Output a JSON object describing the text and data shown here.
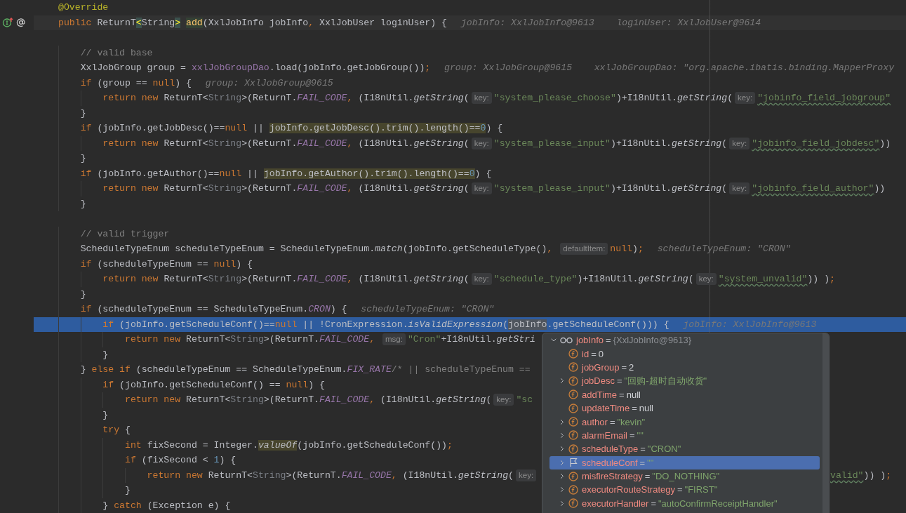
{
  "editor": {
    "lines": [
      {
        "kind": "plain",
        "tokens": [
          {
            "kind": "annotation",
            "text": "@Override"
          }
        ]
      },
      {
        "kind": "caret",
        "gutter_icons": [
          {
            "kind": "implements"
          },
          {
            "kind": "annotation"
          }
        ],
        "tokens": [
          {
            "kind": "keyword",
            "text": "public "
          },
          {
            "kind": "code",
            "text": "ReturnT"
          },
          {
            "kind": "brace",
            "text": "<"
          },
          {
            "kind": "code",
            "text": "String"
          },
          {
            "kind": "brace",
            "text": ">"
          },
          {
            "kind": "declaration",
            "text": "add",
            "highlighted": true
          },
          {
            "kind": "code",
            "text": "(XxlJobInfo jobInfo"
          },
          {
            "kind": "keyword",
            "text": ", "
          },
          {
            "kind": "code",
            "text": "XxlJobUser loginUser) {"
          },
          {
            "kind": "value",
            "text": "jobInfo: XxlJobInfo@9613"
          },
          {
            "kind": "value",
            "text": "loginUser: XxlJobUser@9614"
          }
        ]
      },
      {
        "kind": "plain"
      },
      {
        "kind": "plain",
        "tokens": [
          {
            "kind": "comment",
            "text": "    // valid base"
          }
        ]
      },
      {
        "kind": "plain",
        "tokens": [
          {
            "kind": "code",
            "text": "    XxlJobGroup group = "
          },
          {
            "kind": "field",
            "text": "xxlJobGroupDao"
          },
          {
            "kind": "code",
            "text": ".load(jobInfo.getJobGroup())"
          },
          {
            "kind": "keyword",
            "text": ";"
          },
          {
            "kind": "value",
            "text": "group: XxlJobGroup@9615"
          },
          {
            "kind": "value",
            "text": "xxlJobGroupDao: \"org.apache.ibatis.binding.MapperProxy"
          }
        ]
      },
      {
        "kind": "plain",
        "tokens": [
          {
            "kind": "keyword",
            "text": "    if "
          },
          {
            "kind": "code",
            "text": "(group == "
          },
          {
            "kind": "keyword",
            "text": "null"
          },
          {
            "kind": "code",
            "text": ") {"
          },
          {
            "kind": "value",
            "text": "group: XxlJobGroup@9615"
          }
        ]
      },
      {
        "kind": "plain",
        "tokens": [
          {
            "kind": "keyword",
            "text": "        return new "
          },
          {
            "kind": "code",
            "text": "ReturnT<"
          },
          {
            "kind": "generic",
            "text": "String"
          },
          {
            "kind": "code",
            "text": ">(ReturnT."
          },
          {
            "kind": "constant",
            "text": "FAIL_CODE"
          },
          {
            "kind": "keyword",
            "text": ", "
          },
          {
            "kind": "code",
            "text": "(I18nUtil."
          },
          {
            "kind": "italic",
            "text": "getString"
          },
          {
            "kind": "code",
            "text": "("
          },
          {
            "kind": "hint",
            "text": "key:"
          },
          {
            "kind": "string",
            "text": "\"system_please_choose\""
          },
          {
            "kind": "code",
            "text": ")+I18nUtil."
          },
          {
            "kind": "italic",
            "text": "getString"
          },
          {
            "kind": "code",
            "text": "("
          },
          {
            "kind": "hint",
            "text": "key:"
          },
          {
            "kind": "string",
            "text": "\"jobinfo_field_jobgroup\"",
            "wavy": true
          }
        ]
      },
      {
        "kind": "plain",
        "tokens": [
          {
            "kind": "code",
            "text": "    }"
          }
        ]
      },
      {
        "kind": "plain",
        "tokens": [
          {
            "kind": "keyword",
            "text": "    if "
          },
          {
            "kind": "code",
            "text": "(jobInfo.getJobDesc()=="
          },
          {
            "kind": "keyword",
            "text": "null "
          },
          {
            "kind": "code",
            "text": "|| "
          },
          {
            "kind": "code",
            "text": "jobInfo.getJobDesc().trim().length()==",
            "highlighted": true
          },
          {
            "kind": "number",
            "text": "0",
            "highlighted": true
          },
          {
            "kind": "code",
            "text": ") {"
          }
        ]
      },
      {
        "kind": "plain",
        "tokens": [
          {
            "kind": "keyword",
            "text": "        return new "
          },
          {
            "kind": "code",
            "text": "ReturnT<"
          },
          {
            "kind": "generic",
            "text": "String"
          },
          {
            "kind": "code",
            "text": ">(ReturnT."
          },
          {
            "kind": "constant",
            "text": "FAIL_CODE"
          },
          {
            "kind": "keyword",
            "text": ", "
          },
          {
            "kind": "code",
            "text": "(I18nUtil."
          },
          {
            "kind": "italic",
            "text": "getString"
          },
          {
            "kind": "code",
            "text": "("
          },
          {
            "kind": "hint",
            "text": "key:"
          },
          {
            "kind": "string",
            "text": "\"system_please_input\""
          },
          {
            "kind": "code",
            "text": ")+I18nUtil."
          },
          {
            "kind": "italic",
            "text": "getString"
          },
          {
            "kind": "code",
            "text": "("
          },
          {
            "kind": "hint",
            "text": "key:"
          },
          {
            "kind": "string",
            "text": "\"jobinfo_field_jobdesc\"",
            "wavy": true
          },
          {
            "kind": "code",
            "text": "))"
          }
        ]
      },
      {
        "kind": "plain",
        "tokens": [
          {
            "kind": "code",
            "text": "    }"
          }
        ]
      },
      {
        "kind": "plain",
        "tokens": [
          {
            "kind": "keyword",
            "text": "    if "
          },
          {
            "kind": "code",
            "text": "(jobInfo.getAuthor()=="
          },
          {
            "kind": "keyword",
            "text": "null "
          },
          {
            "kind": "code",
            "text": "|| "
          },
          {
            "kind": "code",
            "text": "jobInfo.getAuthor().trim().length()==",
            "highlighted": true
          },
          {
            "kind": "number",
            "text": "0",
            "highlighted": true
          },
          {
            "kind": "code",
            "text": ") {"
          }
        ]
      },
      {
        "kind": "plain",
        "tokens": [
          {
            "kind": "keyword",
            "text": "        return new "
          },
          {
            "kind": "code",
            "text": "ReturnT<"
          },
          {
            "kind": "generic",
            "text": "String"
          },
          {
            "kind": "code",
            "text": ">(ReturnT."
          },
          {
            "kind": "constant",
            "text": "FAIL_CODE"
          },
          {
            "kind": "keyword",
            "text": ", "
          },
          {
            "kind": "code",
            "text": "(I18nUtil."
          },
          {
            "kind": "italic",
            "text": "getString"
          },
          {
            "kind": "code",
            "text": "("
          },
          {
            "kind": "hint",
            "text": "key:"
          },
          {
            "kind": "string",
            "text": "\"system_please_input\""
          },
          {
            "kind": "code",
            "text": ")+I18nUtil."
          },
          {
            "kind": "italic",
            "text": "getString"
          },
          {
            "kind": "code",
            "text": "("
          },
          {
            "kind": "hint",
            "text": "key:"
          },
          {
            "kind": "string",
            "text": "\"jobinfo_field_author\"",
            "wavy": true
          },
          {
            "kind": "code",
            "text": "))"
          }
        ]
      },
      {
        "kind": "plain",
        "tokens": [
          {
            "kind": "code",
            "text": "    }"
          }
        ]
      },
      {
        "kind": "plain"
      },
      {
        "kind": "plain",
        "tokens": [
          {
            "kind": "comment",
            "text": "    // valid trigger"
          }
        ]
      },
      {
        "kind": "plain",
        "tokens": [
          {
            "kind": "code",
            "text": "    ScheduleTypeEnum scheduleTypeEnum = ScheduleTypeEnum."
          },
          {
            "kind": "italic",
            "text": "match"
          },
          {
            "kind": "code",
            "text": "(jobInfo.getScheduleType()"
          },
          {
            "kind": "keyword",
            "text": ", "
          },
          {
            "kind": "hint",
            "text": "defaultItem:"
          },
          {
            "kind": "keyword",
            "text": "null"
          },
          {
            "kind": "code",
            "text": ")"
          },
          {
            "kind": "keyword",
            "text": ";"
          },
          {
            "kind": "value",
            "text": "scheduleTypeEnum: \"CRON\""
          }
        ]
      },
      {
        "kind": "plain",
        "tokens": [
          {
            "kind": "keyword",
            "text": "    if "
          },
          {
            "kind": "code",
            "text": "(scheduleTypeEnum == "
          },
          {
            "kind": "keyword",
            "text": "null"
          },
          {
            "kind": "code",
            "text": ") {"
          }
        ]
      },
      {
        "kind": "plain",
        "tokens": [
          {
            "kind": "keyword",
            "text": "        return new "
          },
          {
            "kind": "code",
            "text": "ReturnT<"
          },
          {
            "kind": "generic",
            "text": "String"
          },
          {
            "kind": "code",
            "text": ">(ReturnT."
          },
          {
            "kind": "constant",
            "text": "FAIL_CODE"
          },
          {
            "kind": "keyword",
            "text": ", "
          },
          {
            "kind": "code",
            "text": "(I18nUtil."
          },
          {
            "kind": "italic",
            "text": "getString"
          },
          {
            "kind": "code",
            "text": "("
          },
          {
            "kind": "hint",
            "text": "key:"
          },
          {
            "kind": "string",
            "text": "\"schedule_type\""
          },
          {
            "kind": "code",
            "text": ")+I18nUtil."
          },
          {
            "kind": "italic",
            "text": "getString"
          },
          {
            "kind": "code",
            "text": "("
          },
          {
            "kind": "hint",
            "text": "key:"
          },
          {
            "kind": "string",
            "text": "\"system_unvalid\"",
            "wavy": true
          },
          {
            "kind": "code",
            "text": ")) )"
          },
          {
            "kind": "keyword",
            "text": ";"
          }
        ]
      },
      {
        "kind": "plain",
        "tokens": [
          {
            "kind": "code",
            "text": "    }"
          }
        ]
      },
      {
        "kind": "plain",
        "tokens": [
          {
            "kind": "keyword",
            "text": "    if "
          },
          {
            "kind": "code",
            "text": "(scheduleTypeEnum == ScheduleTypeEnum."
          },
          {
            "kind": "constant",
            "text": "CRON"
          },
          {
            "kind": "code",
            "text": ") {"
          },
          {
            "kind": "value",
            "text": "scheduleTypeEnum: \"CRON\""
          }
        ]
      },
      {
        "kind": "current",
        "tokens": [
          {
            "kind": "keyword",
            "text": "        if "
          },
          {
            "kind": "code",
            "text": "(jobInfo.getScheduleConf()=="
          },
          {
            "kind": "keyword",
            "text": "null "
          },
          {
            "kind": "code",
            "text": "|| !CronExpression."
          },
          {
            "kind": "italic",
            "text": "isValidExpression"
          },
          {
            "kind": "code",
            "text": "("
          },
          {
            "kind": "code",
            "text": "jobInfo",
            "highlighted": true
          },
          {
            "kind": "code",
            "text": ".getScheduleConf())) {"
          },
          {
            "kind": "value",
            "text": "jobInfo: XxlJobInfo@9613"
          }
        ]
      },
      {
        "kind": "plain",
        "tokens": [
          {
            "kind": "keyword",
            "text": "            return new "
          },
          {
            "kind": "code",
            "text": "ReturnT<"
          },
          {
            "kind": "generic",
            "text": "String"
          },
          {
            "kind": "code",
            "text": ">(ReturnT."
          },
          {
            "kind": "constant",
            "text": "FAIL_CODE"
          },
          {
            "kind": "keyword",
            "text": ", "
          },
          {
            "kind": "hint",
            "text": "msg:"
          },
          {
            "kind": "string",
            "text": "\"Cron\""
          },
          {
            "kind": "code",
            "text": "+I18nUtil."
          },
          {
            "kind": "italic",
            "text": "getStri"
          }
        ]
      },
      {
        "kind": "plain",
        "tokens": [
          {
            "kind": "code",
            "text": "        }"
          }
        ]
      },
      {
        "kind": "plain",
        "tokens": [
          {
            "kind": "code",
            "text": "    } "
          },
          {
            "kind": "keyword",
            "text": "else if "
          },
          {
            "kind": "code",
            "text": "(scheduleTypeEnum == ScheduleTypeEnum."
          },
          {
            "kind": "constant",
            "text": "FIX_RATE"
          },
          {
            "kind": "comment",
            "text": "/* || scheduleTypeEnum =="
          }
        ]
      },
      {
        "kind": "plain",
        "tokens": [
          {
            "kind": "keyword",
            "text": "        if "
          },
          {
            "kind": "code",
            "text": "(jobInfo.getScheduleConf() == "
          },
          {
            "kind": "keyword",
            "text": "null"
          },
          {
            "kind": "code",
            "text": ") {"
          }
        ]
      },
      {
        "kind": "plain",
        "tokens": [
          {
            "kind": "keyword",
            "text": "            return new "
          },
          {
            "kind": "code",
            "text": "ReturnT<"
          },
          {
            "kind": "generic",
            "text": "String"
          },
          {
            "kind": "code",
            "text": ">(ReturnT."
          },
          {
            "kind": "constant",
            "text": "FAIL_CODE"
          },
          {
            "kind": "keyword",
            "text": ", "
          },
          {
            "kind": "code",
            "text": "(I18nUtil."
          },
          {
            "kind": "italic",
            "text": "getString"
          },
          {
            "kind": "code",
            "text": "("
          },
          {
            "kind": "hint",
            "text": "key:"
          },
          {
            "kind": "string",
            "text": "\"sc"
          }
        ]
      },
      {
        "kind": "plain",
        "tokens": [
          {
            "kind": "code",
            "text": "        }"
          }
        ]
      },
      {
        "kind": "plain",
        "tokens": [
          {
            "kind": "keyword",
            "text": "        try "
          },
          {
            "kind": "code",
            "text": "{"
          }
        ]
      },
      {
        "kind": "plain",
        "tokens": [
          {
            "kind": "keyword",
            "text": "            int "
          },
          {
            "kind": "code",
            "text": "fixSecond = Integer."
          },
          {
            "kind": "italic",
            "text": "valueOf",
            "highlighted": true
          },
          {
            "kind": "code",
            "text": "(jobInfo.getScheduleConf())"
          },
          {
            "kind": "keyword",
            "text": ";"
          }
        ]
      },
      {
        "kind": "plain",
        "tokens": [
          {
            "kind": "keyword",
            "text": "            if "
          },
          {
            "kind": "code",
            "text": "(fixSecond < "
          },
          {
            "kind": "number",
            "text": "1"
          },
          {
            "kind": "code",
            "text": ") {"
          }
        ]
      },
      {
        "kind": "plain",
        "tokens": [
          {
            "kind": "keyword",
            "text": "                return new "
          },
          {
            "kind": "code",
            "text": "ReturnT<"
          },
          {
            "kind": "generic",
            "text": "String"
          },
          {
            "kind": "code",
            "text": ">(ReturnT."
          },
          {
            "kind": "constant",
            "text": "FAIL_CODE"
          },
          {
            "kind": "keyword",
            "text": ", "
          },
          {
            "kind": "code",
            "text": "(I18nUtil."
          },
          {
            "kind": "italic",
            "text": "getString"
          },
          {
            "kind": "code",
            "text": "("
          },
          {
            "kind": "hint",
            "text": "key:"
          }
        ],
        "tail": [
          {
            "kind": "string",
            "text": "valid\"",
            "wavy": true
          },
          {
            "kind": "code",
            "text": ")) )"
          },
          {
            "kind": "keyword",
            "text": ";"
          }
        ]
      },
      {
        "kind": "plain",
        "tokens": [
          {
            "kind": "code",
            "text": "            }"
          }
        ]
      },
      {
        "kind": "plain",
        "tokens": [
          {
            "kind": "code",
            "text": "        } "
          },
          {
            "kind": "keyword",
            "text": "catch "
          },
          {
            "kind": "code",
            "text": "(Exception e) {"
          }
        ]
      }
    ]
  },
  "debug_popup": {
    "root": {
      "kind": "watch",
      "expandable": true,
      "expanded": true,
      "name": "jobInfo",
      "op": "=",
      "value": "{XxlJobInfo@9613}",
      "selected": false,
      "children": [
        {
          "kind": "field",
          "expandable": false,
          "name": "id",
          "op": "=",
          "value": "0",
          "is_string": false,
          "selected": false
        },
        {
          "kind": "field",
          "expandable": false,
          "name": "jobGroup",
          "op": "=",
          "value": "2",
          "is_string": false,
          "selected": false
        },
        {
          "kind": "field",
          "expandable": true,
          "name": "jobDesc",
          "op": "=",
          "value": "\"回购-超时自动收货\"",
          "is_string": true,
          "selected": false
        },
        {
          "kind": "field",
          "expandable": false,
          "name": "addTime",
          "op": "=",
          "value": "null",
          "is_string": false,
          "selected": false
        },
        {
          "kind": "field",
          "expandable": false,
          "name": "updateTime",
          "op": "=",
          "value": "null",
          "is_string": false,
          "selected": false
        },
        {
          "kind": "field",
          "expandable": true,
          "name": "author",
          "op": "=",
          "value": "\"kevin\"",
          "is_string": true,
          "selected": false
        },
        {
          "kind": "field",
          "expandable": true,
          "name": "alarmEmail",
          "op": "=",
          "value": "\"\"",
          "is_string": true,
          "selected": false
        },
        {
          "kind": "field",
          "expandable": true,
          "name": "scheduleType",
          "op": "=",
          "value": "\"CRON\"",
          "is_string": true,
          "selected": false
        },
        {
          "kind": "flag",
          "expandable": true,
          "name": "scheduleConf",
          "op": "=",
          "value": "\"\"",
          "is_string": true,
          "selected": true
        },
        {
          "kind": "field",
          "expandable": true,
          "name": "misfireStrategy",
          "op": "=",
          "value": "\"DO_NOTHING\"",
          "is_string": true,
          "selected": false
        },
        {
          "kind": "field",
          "expandable": true,
          "name": "executorRouteStrategy",
          "op": "=",
          "value": "\"FIRST\"",
          "is_string": true,
          "selected": false
        },
        {
          "kind": "field",
          "expandable": true,
          "name": "executorHandler",
          "op": "=",
          "value": "\"autoConfirmReceiptHandler\"",
          "is_string": true,
          "selected": false
        }
      ]
    }
  }
}
